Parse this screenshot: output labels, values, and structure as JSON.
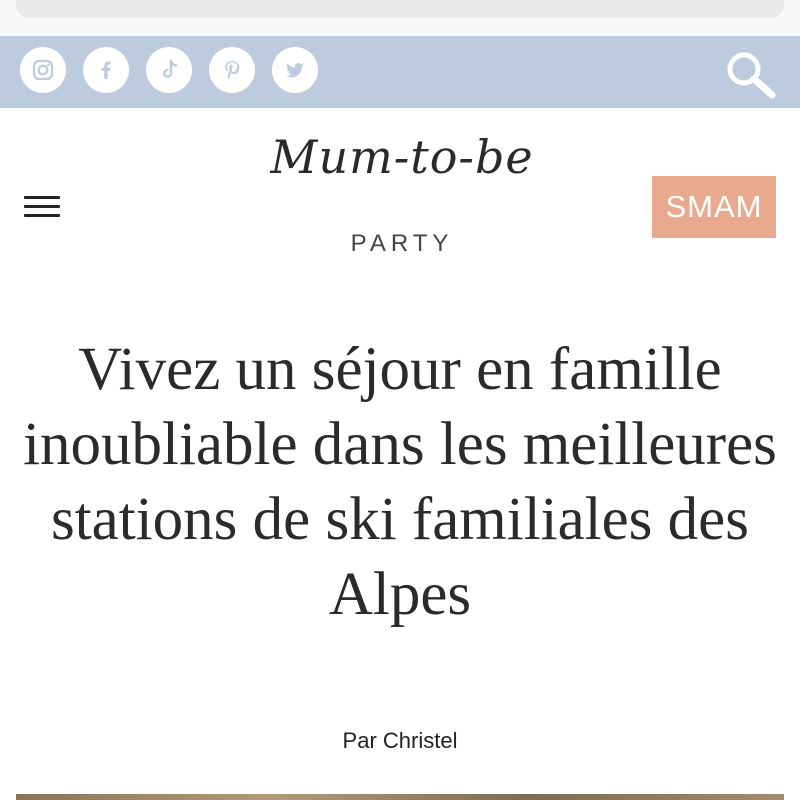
{
  "social_links": [
    {
      "name": "instagram",
      "icon": "instagram-icon"
    },
    {
      "name": "facebook",
      "icon": "facebook-icon"
    },
    {
      "name": "tiktok",
      "icon": "tiktok-icon"
    },
    {
      "name": "pinterest",
      "icon": "pinterest-icon"
    },
    {
      "name": "twitter",
      "icon": "twitter-icon"
    }
  ],
  "header": {
    "logo_script": "Mum-to-be",
    "logo_sub": "PARTY",
    "cta_label": "SMAM",
    "menu_icon": "hamburger-menu-icon",
    "search_icon": "search-icon"
  },
  "article": {
    "title": "Vivez un séjour en famille inoubliable dans les meilleures stations de ski familiales des Alpes",
    "author": "Par Christel"
  },
  "colors": {
    "topbar": "#bccbdd",
    "cta_background": "#e9a98e",
    "text": "#2b2b2b"
  }
}
